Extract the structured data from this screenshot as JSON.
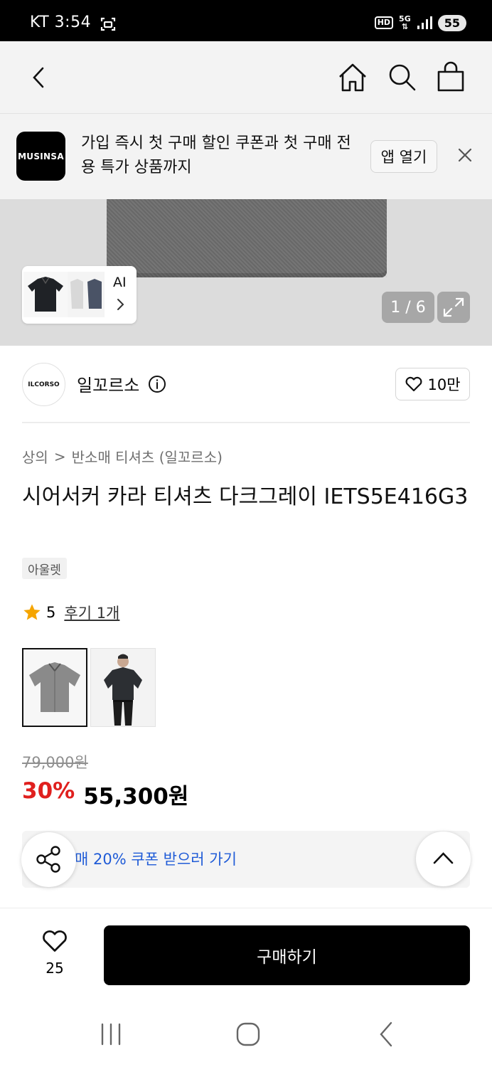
{
  "status": {
    "carrier": "KT",
    "time": "3:54",
    "hd": "HD",
    "network": "5G",
    "battery": "55"
  },
  "promo": {
    "logo_text": "MUSINSA",
    "message": "가입 즉시 첫 구매 할인 쿠폰과 첫 구매 전용 특가 상품까지",
    "open_label": "앱 열기"
  },
  "gallery": {
    "ai_label": "AI",
    "page_counter": "1 / 6"
  },
  "brand": {
    "logo_text": "ILCORSO",
    "name": "일꼬르소",
    "likes": "10만"
  },
  "breadcrumb": {
    "category": "상의",
    "separator": ">",
    "subcategory": "반소매 티셔츠 (일꼬르소)"
  },
  "product": {
    "title": "시어서커 카라 티셔츠 다크그레이 IETS5E416G3",
    "badge": "아울렛",
    "rating": "5",
    "review_label": "후기 1개",
    "original_price": "79,000원",
    "discount": "30%",
    "sale_price": "55,300원"
  },
  "coupon": {
    "text": "매 20% 쿠폰 받으러 가기"
  },
  "bottom": {
    "wish_count": "25",
    "buy_label": "구매하기"
  },
  "colors": {
    "accent_red": "#e0201e",
    "link_blue": "#1f5bd7",
    "star": "#f5a500"
  }
}
